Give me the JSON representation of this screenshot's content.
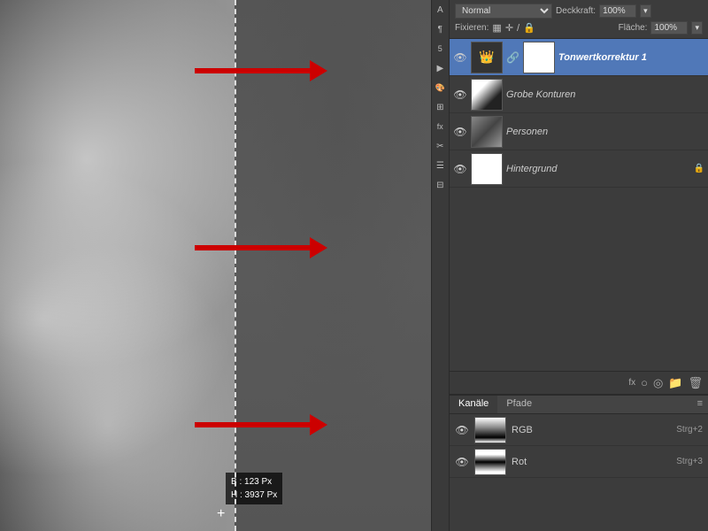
{
  "canvas": {
    "info_b": "B :  123 Px",
    "info_h": "H : 3937 Px"
  },
  "toolbar_strip": {
    "icons": [
      "A",
      "¶",
      "5",
      "▶",
      "🎨",
      "⊞",
      "fx",
      "✂",
      "☷",
      "⊟"
    ]
  },
  "panel": {
    "blend_mode": "Normal",
    "opacity_label": "Deckkraft:",
    "opacity_value": "100%",
    "fix_label": "Fixieren:",
    "flache_label": "Fläche:",
    "flache_value": "100%",
    "layers": [
      {
        "name": "Tonwertkorrektur 1",
        "type": "adjustment",
        "thumb_type": "crown",
        "has_mask": true,
        "mask_white": true,
        "visible": true,
        "locked": false,
        "selected": true
      },
      {
        "name": "Grobe Konturen",
        "type": "normal",
        "thumb_type": "dark_texture",
        "has_mask": false,
        "visible": true,
        "locked": false,
        "selected": false
      },
      {
        "name": "Personen",
        "type": "normal",
        "thumb_type": "persons",
        "has_mask": false,
        "visible": true,
        "locked": false,
        "selected": false
      },
      {
        "name": "Hintergrund",
        "type": "normal",
        "thumb_type": "white",
        "has_mask": false,
        "visible": true,
        "locked": true,
        "selected": false
      }
    ],
    "bottom_icons": [
      "fx",
      "○",
      "◎",
      "📁",
      "🗑"
    ]
  },
  "channels": {
    "tab_active": "Kanäle",
    "tab_inactive": "Pfade",
    "items": [
      {
        "name": "RGB",
        "shortcut": "Strg+2",
        "type": "rgb"
      },
      {
        "name": "Rot",
        "shortcut": "Strg+3",
        "type": "rot"
      }
    ]
  }
}
